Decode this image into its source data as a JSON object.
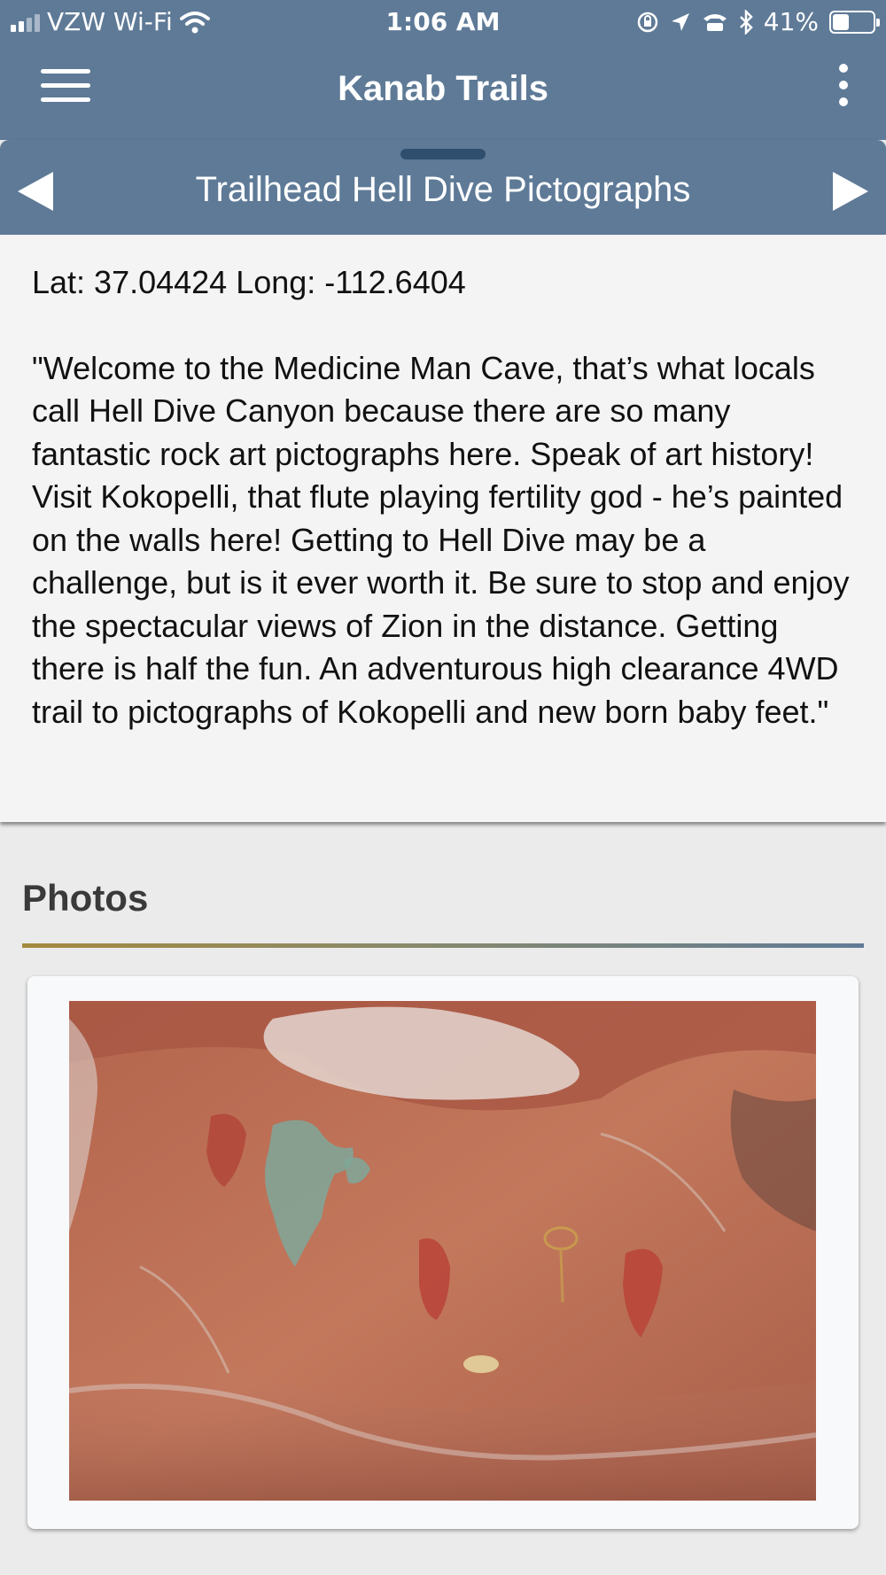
{
  "status_bar": {
    "carrier": "VZW Wi-Fi",
    "time": "1:06 AM",
    "battery_percent": "41%",
    "battery_level": 0.41,
    "icons": [
      "signal-icon",
      "wifi-icon",
      "orientation-lock-icon",
      "location-arrow-icon",
      "tty-icon",
      "bluetooth-icon",
      "battery-icon"
    ]
  },
  "app_bar": {
    "title": "Kanab Trails",
    "menu_icon": "hamburger-menu-icon",
    "more_icon": "kebab-more-icon"
  },
  "detail_sheet": {
    "title": "Trailhead Hell Dive Pictographs",
    "coordinates": "Lat: 37.04424 Long: -112.6404",
    "description": "\"Welcome to the Medicine Man Cave, that’s what locals call Hell Dive Canyon because there are so many fantastic rock art pictographs here. Speak of art history! Visit Kokopelli, that flute playing fertility god - he’s painted on the walls here! Getting to Hell Dive may be a challenge, but is it ever worth it. Be sure to stop and enjoy the spectacular views of Zion in the distance. Getting there is half the fun. An adventurous high clearance 4WD trail to pictographs of Kokopelli and new born baby feet.\"",
    "prev_icon": "arrow-left-icon",
    "next_icon": "arrow-right-icon"
  },
  "photos": {
    "heading": "Photos"
  },
  "colors": {
    "header": "#5e7a97",
    "handle": "#2f4e6e",
    "sheet_bg": "#f4f4f4",
    "page_bg": "#ebebeb",
    "rule_start": "#a58a3e",
    "rule_end": "#607b96"
  }
}
